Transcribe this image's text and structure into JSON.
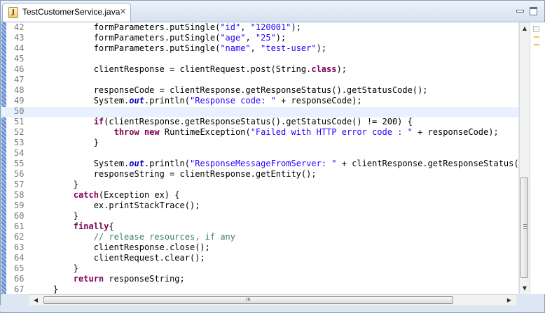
{
  "tab": {
    "title": "TestCustomerService.java",
    "icon": "java-file-icon",
    "close_glyph": "✕"
  },
  "window": {
    "minimize_icon": "minimize-icon",
    "maximize_icon": "maximize-icon"
  },
  "scrollbar": {
    "up": "▲",
    "down": "▼",
    "left": "◀",
    "right": "▶",
    "grip": "III"
  },
  "current_line": 50,
  "lines": [
    {
      "n": "42",
      "s": [
        {
          "t": "            formParameters.putSingle("
        },
        {
          "c": "str",
          "t": "\"id\""
        },
        {
          "t": ", "
        },
        {
          "c": "str",
          "t": "\"120001\""
        },
        {
          "t": ");"
        }
      ]
    },
    {
      "n": "43",
      "s": [
        {
          "t": "            formParameters.putSingle("
        },
        {
          "c": "str",
          "t": "\"age\""
        },
        {
          "t": ", "
        },
        {
          "c": "str",
          "t": "\"25\""
        },
        {
          "t": ");"
        }
      ]
    },
    {
      "n": "44",
      "s": [
        {
          "t": "            formParameters.putSingle("
        },
        {
          "c": "str",
          "t": "\"name\""
        },
        {
          "t": ", "
        },
        {
          "c": "str",
          "t": "\"test-user\""
        },
        {
          "t": ");"
        }
      ]
    },
    {
      "n": "45",
      "s": []
    },
    {
      "n": "46",
      "s": [
        {
          "t": "            clientResponse = clientRequest.post(String."
        },
        {
          "c": "kw",
          "t": "class"
        },
        {
          "t": ");"
        }
      ]
    },
    {
      "n": "47",
      "s": []
    },
    {
      "n": "48",
      "s": [
        {
          "t": "            responseCode = clientResponse.getResponseStatus().getStatusCode();"
        }
      ]
    },
    {
      "n": "49",
      "s": [
        {
          "t": "            System."
        },
        {
          "c": "fld",
          "t": "out"
        },
        {
          "t": ".println("
        },
        {
          "c": "str",
          "t": "\"Response code: \""
        },
        {
          "t": " + responseCode);"
        }
      ]
    },
    {
      "n": "50",
      "s": []
    },
    {
      "n": "51",
      "s": [
        {
          "t": "            "
        },
        {
          "c": "kw",
          "t": "if"
        },
        {
          "t": "(clientResponse.getResponseStatus().getStatusCode() != 200) {"
        }
      ]
    },
    {
      "n": "52",
      "s": [
        {
          "t": "                "
        },
        {
          "c": "kw",
          "t": "throw"
        },
        {
          "t": " "
        },
        {
          "c": "kw",
          "t": "new"
        },
        {
          "t": " RuntimeException("
        },
        {
          "c": "str",
          "t": "\"Failed with HTTP error code : \""
        },
        {
          "t": " + responseCode);"
        }
      ]
    },
    {
      "n": "53",
      "s": [
        {
          "t": "            }"
        }
      ]
    },
    {
      "n": "54",
      "s": []
    },
    {
      "n": "55",
      "s": [
        {
          "t": "            System."
        },
        {
          "c": "fld",
          "t": "out"
        },
        {
          "t": ".println("
        },
        {
          "c": "str",
          "t": "\"ResponseMessageFromServer: \""
        },
        {
          "t": " + clientResponse.getResponseStatus().g"
        }
      ]
    },
    {
      "n": "56",
      "s": [
        {
          "t": "            responseString = clientResponse.getEntity();"
        }
      ]
    },
    {
      "n": "57",
      "s": [
        {
          "t": "        }"
        }
      ]
    },
    {
      "n": "58",
      "s": [
        {
          "t": "        "
        },
        {
          "c": "kw",
          "t": "catch"
        },
        {
          "t": "(Exception ex) {"
        }
      ]
    },
    {
      "n": "59",
      "s": [
        {
          "t": "            ex.printStackTrace();"
        }
      ]
    },
    {
      "n": "60",
      "s": [
        {
          "t": "        }"
        }
      ]
    },
    {
      "n": "61",
      "s": [
        {
          "t": "        "
        },
        {
          "c": "kw",
          "t": "finally"
        },
        {
          "t": "{"
        }
      ]
    },
    {
      "n": "62",
      "s": [
        {
          "t": "            "
        },
        {
          "c": "cmt",
          "t": "// release resources, if any"
        }
      ]
    },
    {
      "n": "63",
      "s": [
        {
          "t": "            clientResponse.close();"
        }
      ]
    },
    {
      "n": "64",
      "s": [
        {
          "t": "            clientRequest.clear();"
        }
      ]
    },
    {
      "n": "65",
      "s": [
        {
          "t": "        }"
        }
      ]
    },
    {
      "n": "66",
      "s": [
        {
          "t": "        "
        },
        {
          "c": "kw",
          "t": "return"
        },
        {
          "t": " responseString;"
        }
      ]
    },
    {
      "n": "67",
      "s": [
        {
          "t": "    }"
        }
      ]
    }
  ]
}
